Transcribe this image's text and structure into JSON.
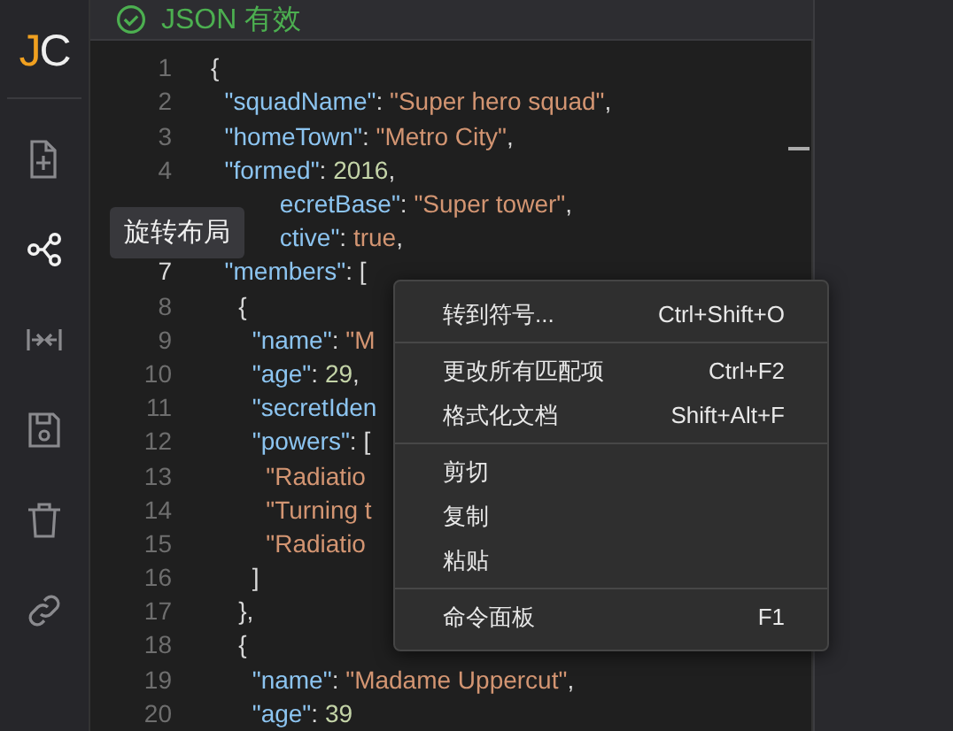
{
  "logo": {
    "first": "J",
    "rest": "C"
  },
  "sidebar": {
    "items": [
      {
        "selected": false
      },
      {
        "selected": true
      },
      {
        "selected": false
      },
      {
        "selected": false
      },
      {
        "selected": false
      },
      {
        "selected": false
      }
    ]
  },
  "tooltip": "旋转布局",
  "status": {
    "valid": true,
    "text": "JSON 有效"
  },
  "editor": {
    "lines": [
      {
        "number": "1",
        "current": false,
        "tokens": [
          {
            "kind": "punct",
            "text": "{"
          }
        ]
      },
      {
        "number": "2",
        "current": false,
        "tokens": [
          {
            "kind": "key",
            "text": "  \"squadName\""
          },
          {
            "kind": "punct",
            "text": ": "
          },
          {
            "kind": "string",
            "text": "\"Super hero squad\""
          },
          {
            "kind": "punct",
            "text": ","
          }
        ]
      },
      {
        "number": "3",
        "current": false,
        "tokens": [
          {
            "kind": "key",
            "text": "  \"homeTown\""
          },
          {
            "kind": "punct",
            "text": ": "
          },
          {
            "kind": "string",
            "text": "\"Metro City\""
          },
          {
            "kind": "punct",
            "text": ","
          }
        ]
      },
      {
        "number": "4",
        "current": false,
        "tokens": [
          {
            "kind": "key",
            "text": "  \"formed\""
          },
          {
            "kind": "punct",
            "text": ": "
          },
          {
            "kind": "number",
            "text": "2016"
          },
          {
            "kind": "punct",
            "text": ","
          }
        ]
      },
      {
        "tokens": [
          {
            "kind": "key",
            "text": "          ecretBase\""
          },
          {
            "kind": "punct",
            "text": ": "
          },
          {
            "kind": "string",
            "text": "\"Super tower\""
          },
          {
            "kind": "punct",
            "text": ","
          }
        ]
      },
      {
        "tokens": [
          {
            "kind": "key",
            "text": "          ctive\""
          },
          {
            "kind": "punct",
            "text": ": "
          },
          {
            "kind": "bool",
            "text": "true"
          },
          {
            "kind": "punct",
            "text": ","
          }
        ]
      },
      {
        "number": "7",
        "current": true,
        "tokens": [
          {
            "kind": "key",
            "text": "  \"members\""
          },
          {
            "kind": "punct",
            "text": ": ["
          }
        ]
      },
      {
        "number": "8",
        "current": false,
        "tokens": [
          {
            "kind": "punct",
            "text": "    {"
          }
        ]
      },
      {
        "number": "9",
        "current": false,
        "tokens": [
          {
            "kind": "key",
            "text": "      \"name\""
          },
          {
            "kind": "punct",
            "text": ": "
          },
          {
            "kind": "string",
            "text": "\"M"
          }
        ]
      },
      {
        "number": "10",
        "current": false,
        "tokens": [
          {
            "kind": "key",
            "text": "      \"age\""
          },
          {
            "kind": "punct",
            "text": ": "
          },
          {
            "kind": "number",
            "text": "29"
          },
          {
            "kind": "punct",
            "text": ","
          }
        ]
      },
      {
        "number": "11",
        "current": false,
        "tokens": [
          {
            "kind": "key",
            "text": "      \"secretIden"
          }
        ]
      },
      {
        "number": "12",
        "current": false,
        "tokens": [
          {
            "kind": "key",
            "text": "      \"powers\""
          },
          {
            "kind": "punct",
            "text": ": ["
          }
        ]
      },
      {
        "number": "13",
        "current": false,
        "tokens": [
          {
            "kind": "string",
            "text": "        \"Radiatio"
          }
        ]
      },
      {
        "number": "14",
        "current": false,
        "tokens": [
          {
            "kind": "string",
            "text": "        \"Turning t"
          }
        ]
      },
      {
        "number": "15",
        "current": false,
        "tokens": [
          {
            "kind": "string",
            "text": "        \"Radiatio"
          }
        ]
      },
      {
        "number": "16",
        "current": false,
        "tokens": [
          {
            "kind": "punct",
            "text": "      ]"
          }
        ]
      },
      {
        "number": "17",
        "current": false,
        "tokens": [
          {
            "kind": "punct",
            "text": "    },"
          }
        ]
      },
      {
        "number": "18",
        "current": false,
        "tokens": [
          {
            "kind": "punct",
            "text": "    {"
          }
        ]
      },
      {
        "number": "19",
        "current": false,
        "tokens": [
          {
            "kind": "key",
            "text": "      \"name\""
          },
          {
            "kind": "punct",
            "text": ": "
          },
          {
            "kind": "string",
            "text": "\"Madame Uppercut\""
          },
          {
            "kind": "punct",
            "text": ","
          }
        ]
      },
      {
        "number": "20",
        "current": false,
        "tokens": [
          {
            "kind": "key",
            "text": "      \"age\""
          },
          {
            "kind": "punct",
            "text": ": "
          },
          {
            "kind": "number",
            "text": "39"
          }
        ]
      }
    ]
  },
  "context_menu": {
    "groups": [
      [
        {
          "label": "转到符号...",
          "shortcut": "Ctrl+Shift+O"
        }
      ],
      [
        {
          "label": "更改所有匹配项",
          "shortcut": "Ctrl+F2"
        },
        {
          "label": "格式化文档",
          "shortcut": "Shift+Alt+F"
        }
      ],
      [
        {
          "label": "剪切"
        },
        {
          "label": "复制"
        },
        {
          "label": "粘贴"
        }
      ],
      [
        {
          "label": "命令面板",
          "shortcut": "F1"
        }
      ]
    ]
  }
}
